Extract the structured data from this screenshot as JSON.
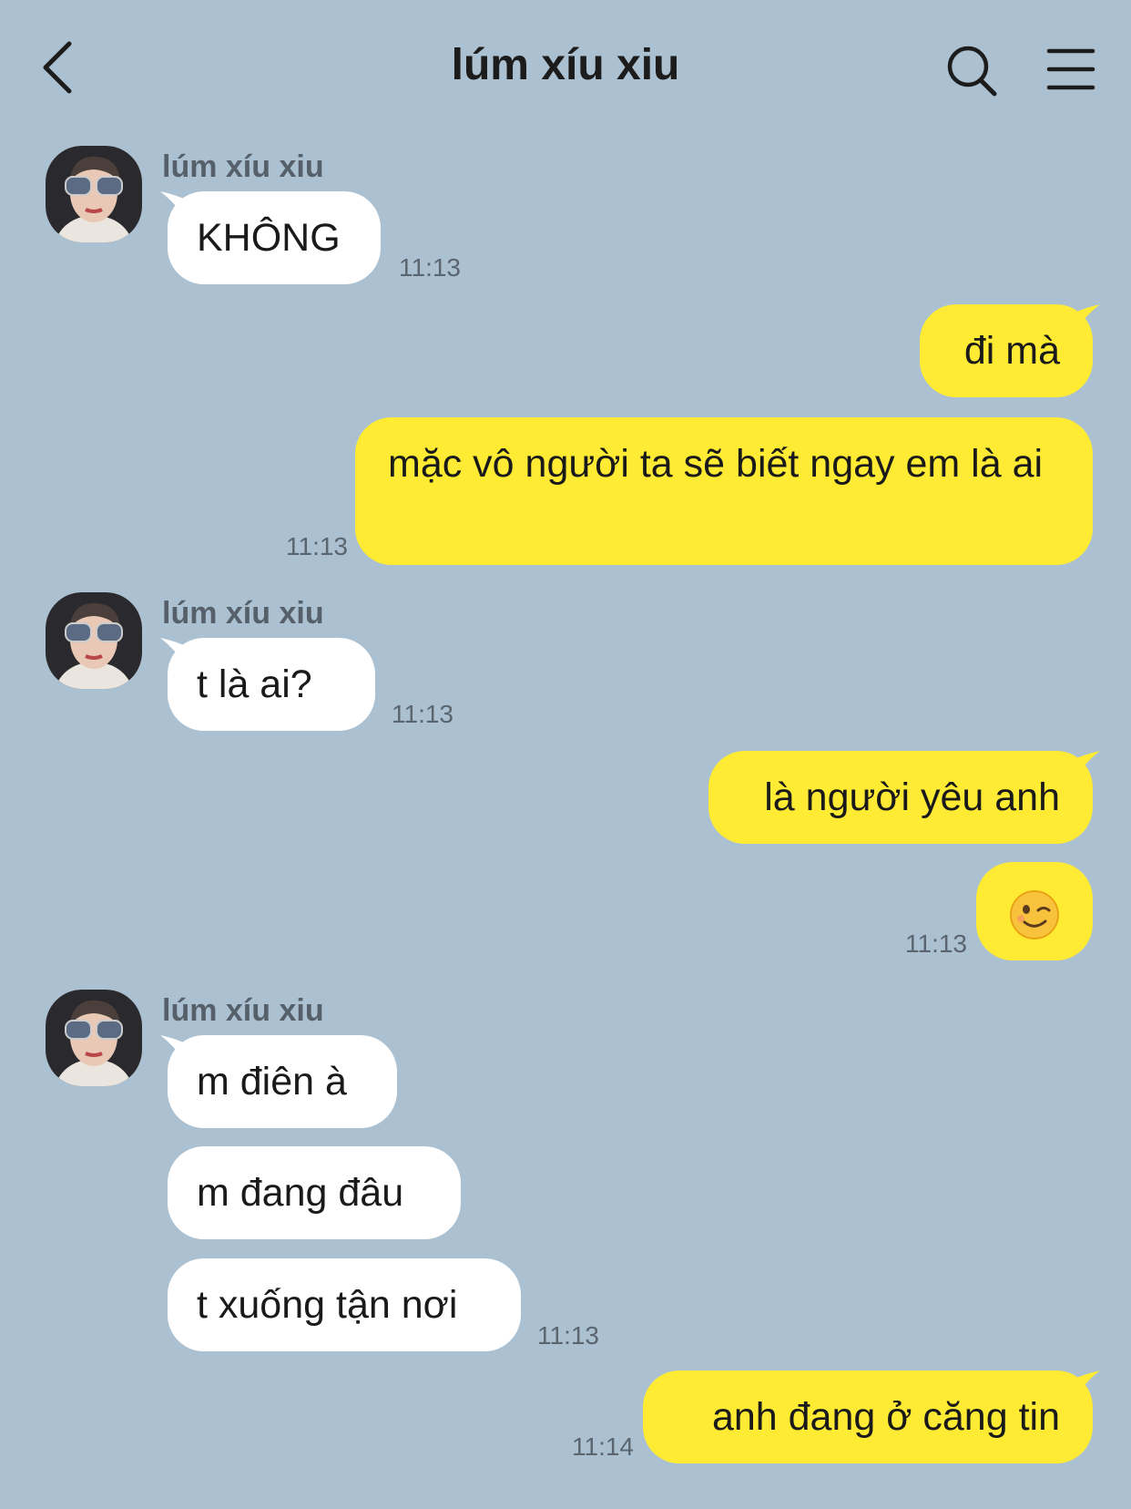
{
  "header": {
    "title": "lúm xíu xiu",
    "back_icon": "chevron-left-icon",
    "search_icon": "search-icon",
    "menu_icon": "hamburger-menu-icon"
  },
  "colors": {
    "background": "#abc1d1",
    "incoming_bubble": "#ffffff",
    "outgoing_bubble": "#ffeb33"
  },
  "contact": {
    "name": "lúm xíu xiu"
  },
  "messages": [
    {
      "from": "them",
      "text": "KHÔNG",
      "time": "11:13"
    },
    {
      "from": "me",
      "text": "đi mà",
      "time": ""
    },
    {
      "from": "me",
      "text": "mặc vô người ta sẽ biết ngay em là ai",
      "time": "11:13"
    },
    {
      "from": "them",
      "text": "t là ai?",
      "time": "11:13"
    },
    {
      "from": "me",
      "text": "là người yêu anh",
      "time": ""
    },
    {
      "from": "me",
      "text": "😉",
      "time": "11:13"
    },
    {
      "from": "them",
      "text": "m điên à",
      "time": ""
    },
    {
      "from": "them",
      "text": "m đang đâu",
      "time": ""
    },
    {
      "from": "them",
      "text": "t xuống tận nơi",
      "time": "11:13"
    },
    {
      "from": "me",
      "text": "anh đang ở căng tin",
      "time": "11:14"
    }
  ]
}
